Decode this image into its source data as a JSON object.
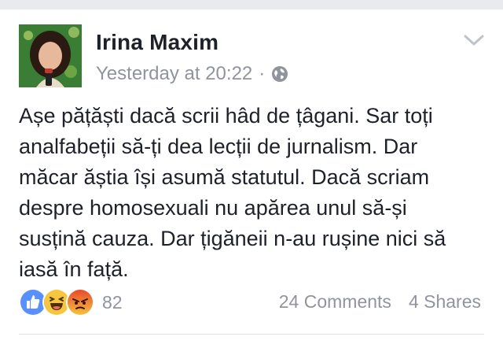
{
  "post": {
    "author": "Irina Maxim",
    "timestamp": "Yesterday at 20:22",
    "separator": "·",
    "privacy_icon": "globe-icon",
    "menu_icon": "chevron-down-icon",
    "text_lines": [
      "Așe pățăști dacă scrii hâd de țâgani. Sar toți",
      "analfabeții să-ți dea lecții de jurnalism. Dar",
      "măcar ăștia își asumă statutul. Dacă scriam",
      "despre homosexuali nu apărea unul să-și",
      "susțină cauza. Dar țigăneii n-au rușine nici să",
      "iasă în față."
    ]
  },
  "reactions": {
    "icons": [
      "like-icon",
      "haha-icon",
      "angry-icon"
    ],
    "count": "82"
  },
  "stats": {
    "comments": "24 Comments",
    "shares": "4 Shares"
  },
  "colors": {
    "like": "#5890ff",
    "haha": "#f7c63d",
    "angry": "#e9710f",
    "meta_gray": "#90949c",
    "text": "#1d2129"
  }
}
